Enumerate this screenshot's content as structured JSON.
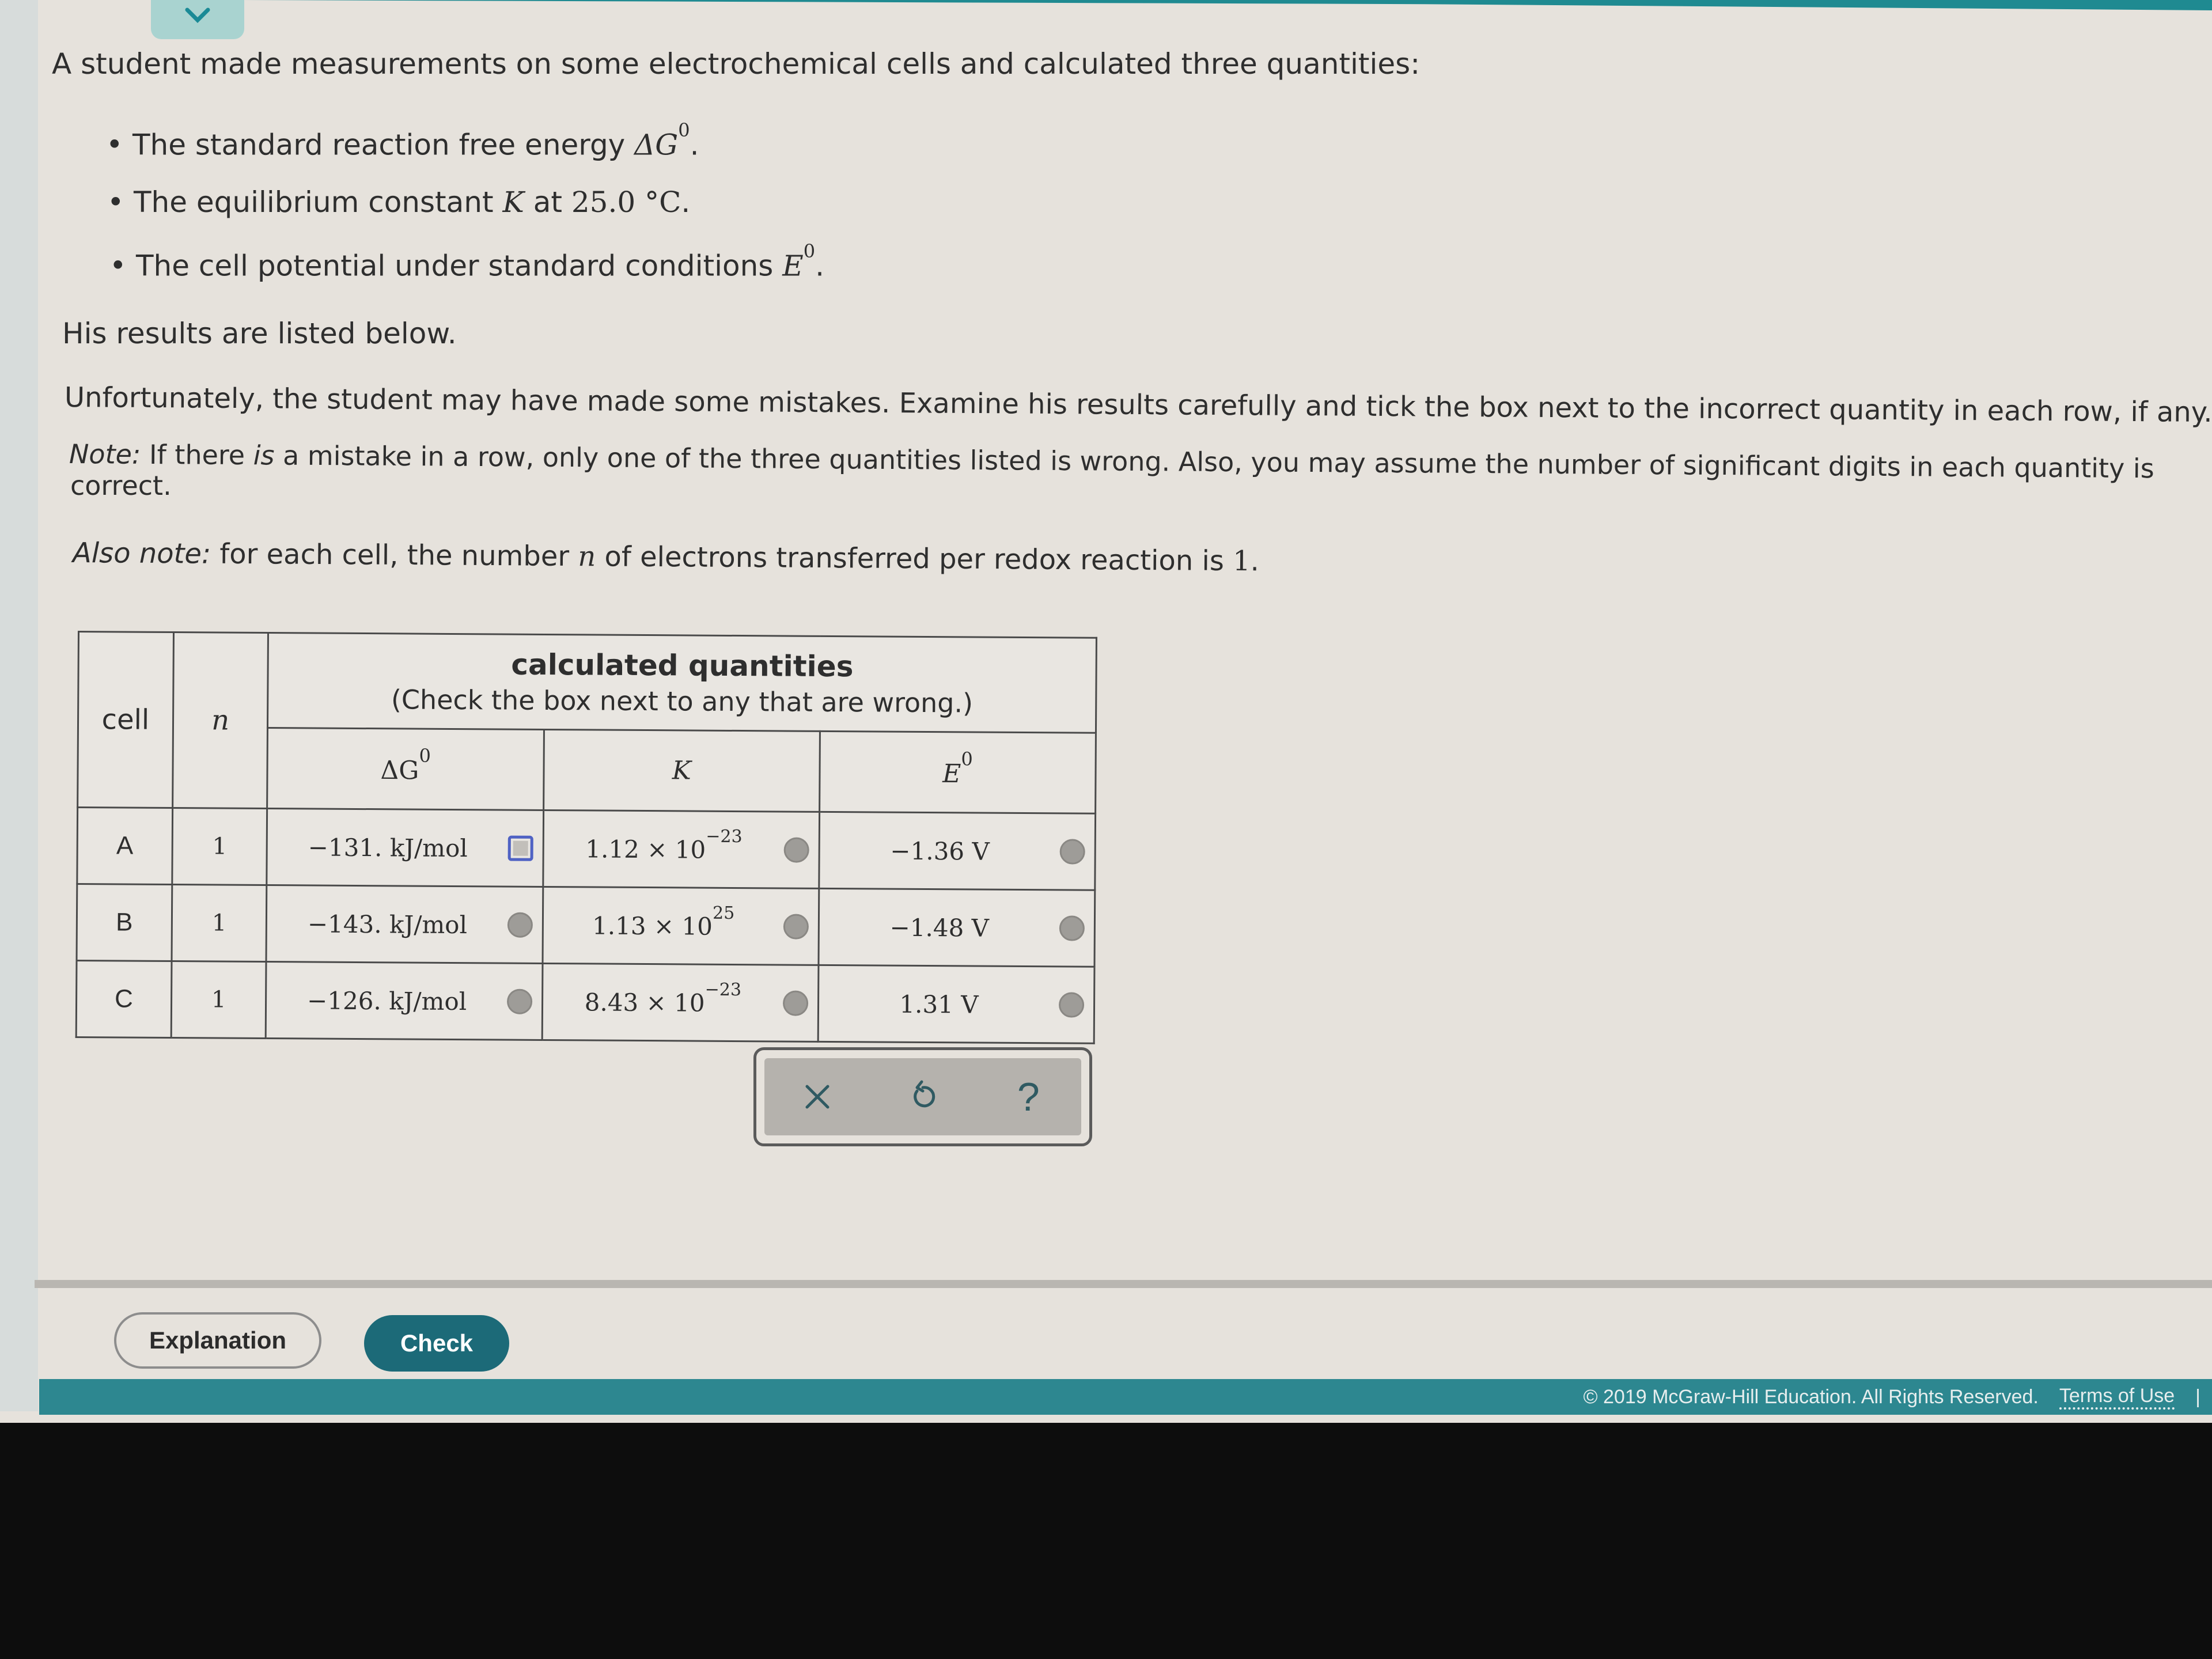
{
  "header": {
    "collapse_icon": "chevron-down-icon"
  },
  "intro": {
    "lead": "A student made measurements on some electrochemical cells and calculated three quantities:",
    "bullets": [
      {
        "text": "The standard reaction free energy ",
        "symbol": "ΔG",
        "sup": "0",
        "tail": "."
      },
      {
        "text": "The equilibrium constant ",
        "symbol": "K",
        "mid": " at ",
        "value": "25.0 °C",
        "tail": "."
      },
      {
        "text": "The cell potential under standard conditions ",
        "symbol": "E",
        "sup": "0",
        "tail": "."
      }
    ],
    "results_line": "His results are listed below.",
    "instruction": "Unfortunately, the student may have made some mistakes. Examine his results carefully and tick the box next to the incorrect quantity in each row, if any.",
    "note_label": "Note:",
    "note_text_1": " If there ",
    "note_is": "is",
    "note_text_2": " a mistake in a row, only one of the three quantities listed is wrong. Also, you may assume the number of significant digits in each quantity is",
    "note_text_3": "correct.",
    "also_note_label": "Also note:",
    "also_note_text_1": " for each cell, the number ",
    "also_note_symbol": "n",
    "also_note_text_2": " of electrons transferred per redox reaction is ",
    "also_note_value": "1",
    "also_note_tail": "."
  },
  "table": {
    "col_cell": "cell",
    "col_n": "n",
    "group_title": "calculated quantities",
    "group_subtitle": "(Check the box next to any that are wrong.)",
    "col_dg": "ΔG",
    "col_dg_sup": "0",
    "col_k": "K",
    "col_e": "E",
    "col_e_sup": "0",
    "rows": [
      {
        "cell": "A",
        "n": "1",
        "dg": "−131. kJ/mol",
        "k_mant": "1.12 × 10",
        "k_exp": "−23",
        "e": "−1.36 V",
        "dg_checked": false,
        "k_checked": false,
        "e_checked": false,
        "focused": "dg"
      },
      {
        "cell": "B",
        "n": "1",
        "dg": "−143. kJ/mol",
        "k_mant": "1.13 × 10",
        "k_exp": "25",
        "e": "−1.48 V",
        "dg_checked": false,
        "k_checked": false,
        "e_checked": false
      },
      {
        "cell": "C",
        "n": "1",
        "dg": "−126. kJ/mol",
        "k_mant": "8.43 × 10",
        "k_exp": "−23",
        "e": "1.31 V",
        "dg_checked": false,
        "k_checked": false,
        "e_checked": false
      }
    ]
  },
  "toolbar": {
    "clear_icon": "close-icon",
    "undo_icon": "undo-icon",
    "help_icon": "help-icon",
    "help_glyph": "?"
  },
  "actions": {
    "explanation_label": "Explanation",
    "check_label": "Check"
  },
  "footer": {
    "copyright": "© 2019 McGraw-Hill Education. All Rights Reserved.",
    "terms_label": "Terms of Use",
    "separator": "|"
  },
  "colors": {
    "accent_teal": "#1c6a78",
    "footer_teal": "#2d8790",
    "focus_blue": "#4f62c4"
  }
}
